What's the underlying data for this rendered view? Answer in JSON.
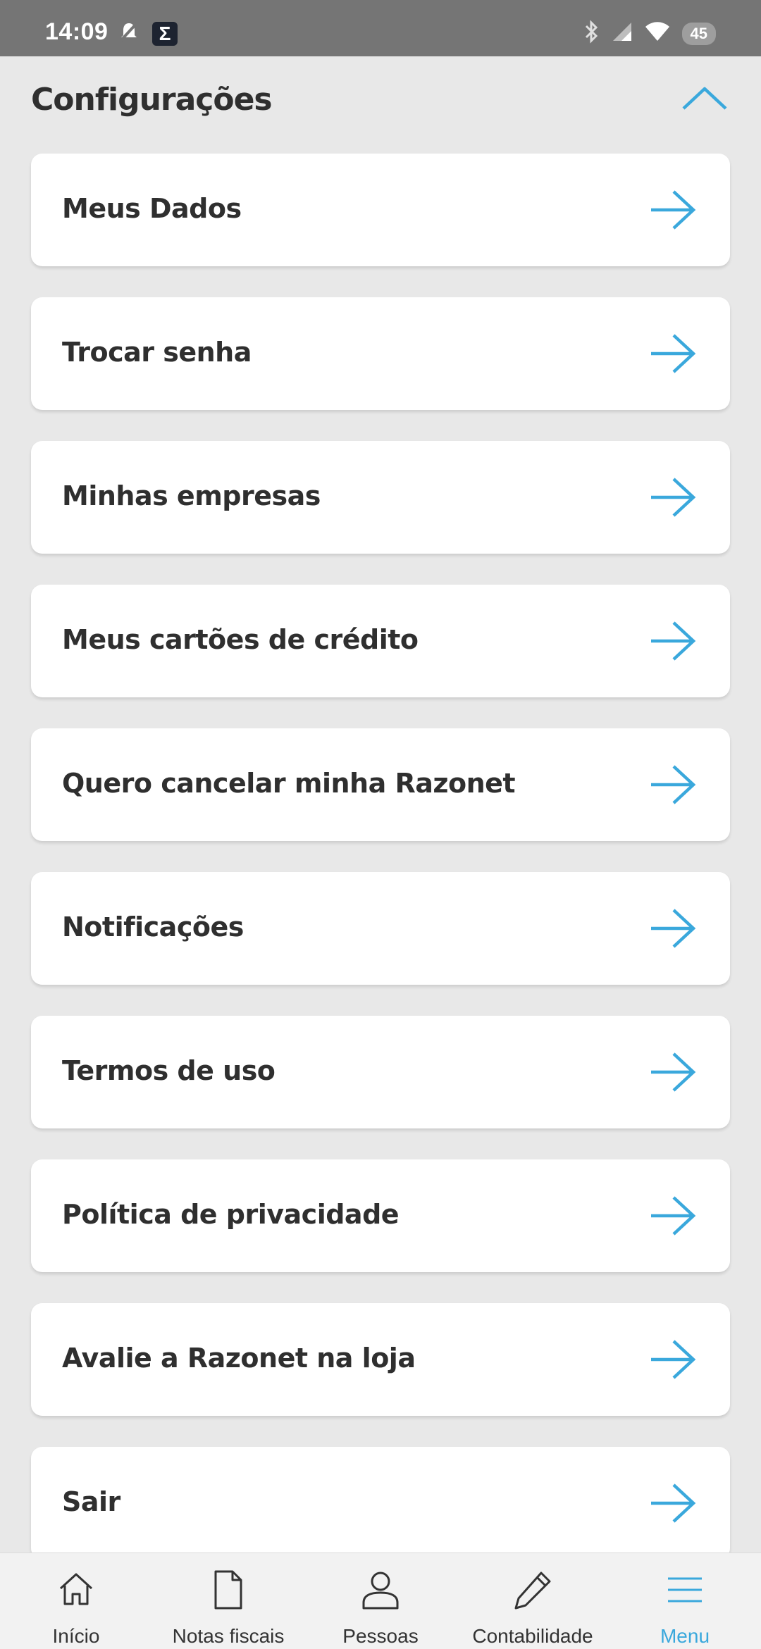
{
  "status_bar": {
    "time": "14:09",
    "battery": "45"
  },
  "header": {
    "title": "Configurações"
  },
  "menu": {
    "items": [
      {
        "label": "Meus Dados"
      },
      {
        "label": "Trocar senha"
      },
      {
        "label": "Minhas empresas"
      },
      {
        "label": "Meus cartões de crédito"
      },
      {
        "label": "Quero cancelar minha Razonet"
      },
      {
        "label": "Notificações"
      },
      {
        "label": "Termos de uso"
      },
      {
        "label": "Política de privacidade"
      },
      {
        "label": "Avalie a Razonet na loja"
      },
      {
        "label": "Sair"
      }
    ]
  },
  "bottom_nav": {
    "items": [
      {
        "label": "Início",
        "icon": "home-icon"
      },
      {
        "label": "Notas fiscais",
        "icon": "document-icon"
      },
      {
        "label": "Pessoas",
        "icon": "person-icon"
      },
      {
        "label": "Contabilidade",
        "icon": "pencil-icon"
      },
      {
        "label": "Menu",
        "icon": "menu-icon",
        "active": true
      }
    ]
  },
  "colors": {
    "accent": "#3aa8dc",
    "background": "#e8e8e8",
    "card": "#ffffff",
    "text": "#2f2f2f"
  }
}
